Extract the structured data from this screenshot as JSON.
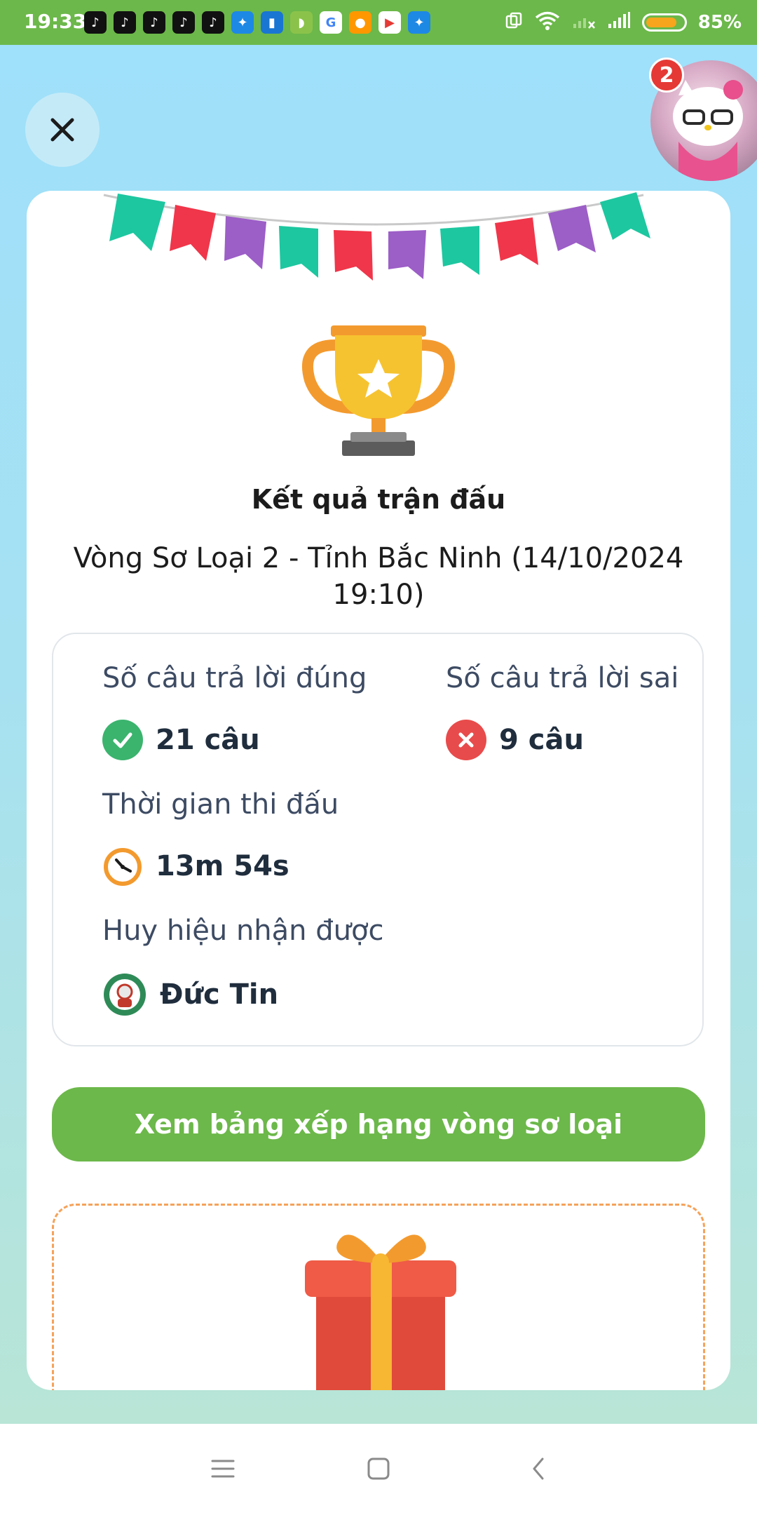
{
  "status_bar": {
    "time": "19:33",
    "battery": "85%",
    "battery_level": 0.85,
    "notification_icons": [
      "tiktok-icon",
      "tiktok-icon",
      "tiktok-icon",
      "tiktok-icon",
      "tiktok-icon",
      "messenger-icon",
      "app-icon",
      "android-icon",
      "google-icon",
      "chat-icon",
      "youtube-icon",
      "messenger-icon"
    ],
    "system_icons": [
      "screenshot-icon",
      "wifi-icon",
      "signal-off-icon",
      "signal-icon"
    ]
  },
  "header": {
    "close_icon": "close-icon",
    "avatar_badge": "2"
  },
  "result": {
    "title": "Kết quả trận đấu",
    "subtitle": "Vòng Sơ Loại 2 - Tỉnh Bắc Ninh (14/10/2024 19:10)",
    "correct_label": "Số câu trả lời đúng",
    "correct_value": "21 câu",
    "wrong_label": "Số câu trả lời sai",
    "wrong_value": "9 câu",
    "time_label": "Thời gian thi đấu",
    "time_value": "13m 54s",
    "badge_label": "Huy hiệu nhận được",
    "badge_value": "Đức Tin"
  },
  "actions": {
    "leaderboard_button": "Xem bảng xếp hạng vòng sơ loại"
  },
  "colors": {
    "primary_green": "#6cb84a",
    "correct": "#3bb46e",
    "wrong": "#e84b4b",
    "gift_border": "#f5a25a"
  }
}
